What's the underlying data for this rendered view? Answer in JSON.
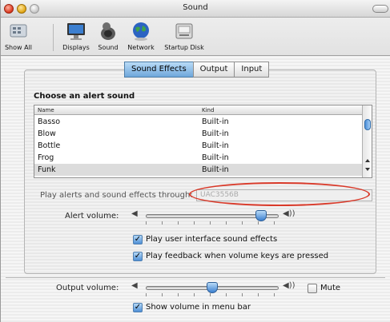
{
  "window": {
    "title": "Sound"
  },
  "toolbar": {
    "items": [
      {
        "label": "Show All",
        "icon": "show-all-icon"
      },
      {
        "label": "Displays",
        "icon": "displays-icon"
      },
      {
        "label": "Sound",
        "icon": "speaker-icon"
      },
      {
        "label": "Network",
        "icon": "network-globe-icon"
      },
      {
        "label": "Startup Disk",
        "icon": "startup-disk-icon"
      }
    ]
  },
  "tabs": [
    {
      "label": "Sound Effects",
      "active": true
    },
    {
      "label": "Output",
      "active": false
    },
    {
      "label": "Input",
      "active": false
    }
  ],
  "sound_effects": {
    "heading": "Choose an alert sound",
    "columns": {
      "name": "Name",
      "kind": "Kind"
    },
    "rows": [
      {
        "name": "Basso",
        "kind": "Built-in",
        "selected": false
      },
      {
        "name": "Blow",
        "kind": "Built-in",
        "selected": false
      },
      {
        "name": "Bottle",
        "kind": "Built-in",
        "selected": false
      },
      {
        "name": "Frog",
        "kind": "Built-in",
        "selected": false
      },
      {
        "name": "Funk",
        "kind": "Built-in",
        "selected": true
      }
    ],
    "play_through_label": "Play alerts and sound effects through:",
    "play_through_device": "UAC3556B",
    "alert_volume_label": "Alert volume:",
    "alert_volume_fraction": 0.87,
    "ui_effects_label": "Play user interface sound effects",
    "ui_effects_checked": true,
    "feedback_label": "Play feedback when volume keys are pressed",
    "feedback_checked": true
  },
  "output": {
    "volume_label": "Output volume:",
    "volume_fraction": 0.5,
    "mute_label": "Mute",
    "mute_checked": false,
    "menu_bar_label": "Show volume in menu bar",
    "menu_bar_checked": true
  },
  "colors": {
    "accent": "#6fa7db",
    "annotation": "#d93a2a"
  }
}
